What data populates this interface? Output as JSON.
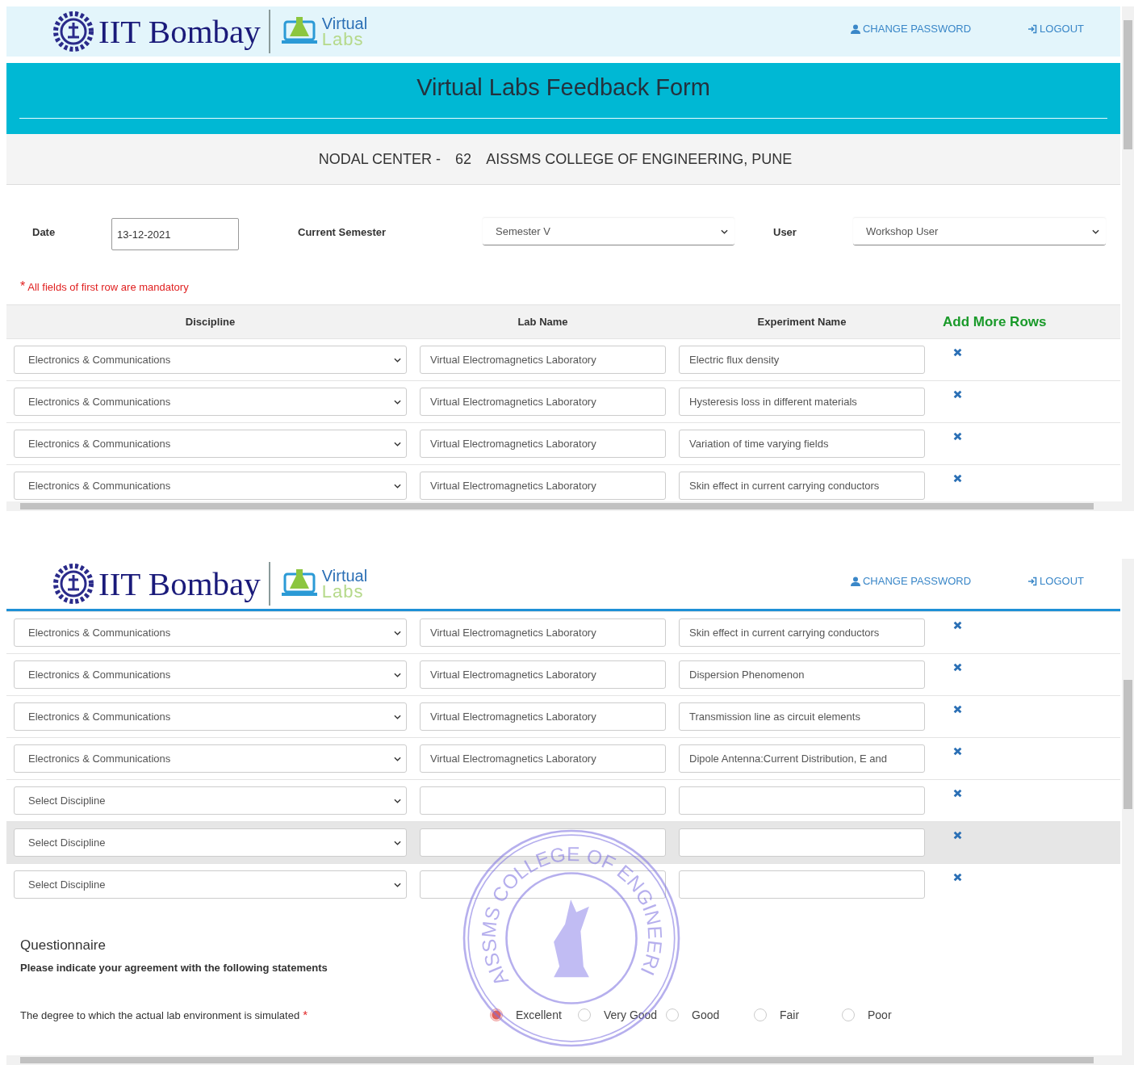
{
  "top_view": {
    "header": {
      "logo_text": "IIT Bombay",
      "labs_logo": {
        "line_1": "Virtual",
        "line_2": "Labs"
      },
      "links": [
        {
          "kind": "password",
          "label": "CHANGE PASSWORD"
        },
        {
          "kind": "logout",
          "label": "LOGOUT"
        }
      ]
    },
    "title": "Virtual Labs Feedback Form",
    "nodal_center": {
      "label": "NODAL CENTER -",
      "code": "62",
      "name": "AISSMS COLLEGE OF ENGINEERING, PUNE"
    },
    "fields": {
      "date": {
        "label": "Date",
        "value": "13-12-2021"
      },
      "semester": {
        "label": "Current Semester",
        "value": "Semester V"
      },
      "user": {
        "label": "User",
        "value": "Workshop User"
      }
    },
    "mandatory_note": {
      "mark": "*",
      "text": "All fields of first row are mandatory"
    },
    "table": {
      "columns": [
        "Discipline",
        "Lab Name",
        "Experiment Name"
      ],
      "add_rows_link": "Add More Rows",
      "rows": [
        {
          "discipline": "Electronics & Communications",
          "lab_name": "Virtual Electromagnetics Laboratory",
          "experiment": "Electric flux density",
          "highlighted": false
        },
        {
          "discipline": "Electronics & Communications",
          "lab_name": "Virtual Electromagnetics Laboratory",
          "experiment": "Hysteresis loss in different materials",
          "highlighted": false
        },
        {
          "discipline": "Electronics & Communications",
          "lab_name": "Virtual Electromagnetics Laboratory",
          "experiment": "Variation of time varying fields",
          "highlighted": false
        },
        {
          "discipline": "Electronics & Communications",
          "lab_name": "Virtual Electromagnetics Laboratory",
          "experiment": "Skin effect in current carrying conductors",
          "highlighted": false
        }
      ]
    }
  },
  "bottom_view": {
    "header": {
      "logo_text": "IIT Bombay",
      "labs_logo": {
        "line_1": "Virtual",
        "line_2": "Labs"
      },
      "links": [
        {
          "kind": "password",
          "label": "CHANGE PASSWORD"
        },
        {
          "kind": "logout",
          "label": "LOGOUT"
        }
      ]
    },
    "rows": [
      {
        "discipline": "Electronics & Communications",
        "lab_name": "Virtual Electromagnetics Laboratory",
        "experiment": "Skin effect in current carrying conductors",
        "highlighted": false
      },
      {
        "discipline": "Electronics & Communications",
        "lab_name": "Virtual Electromagnetics Laboratory",
        "experiment": "Dispersion Phenomenon",
        "highlighted": false
      },
      {
        "discipline": "Electronics & Communications",
        "lab_name": "Virtual Electromagnetics Laboratory",
        "experiment": "Transmission line as circuit elements",
        "highlighted": false
      },
      {
        "discipline": "Electronics & Communications",
        "lab_name": "Virtual Electromagnetics Laboratory",
        "experiment": "Dipole Antenna:Current Distribution, E and",
        "highlighted": false
      },
      {
        "discipline": "Select Discipline",
        "lab_name": "",
        "experiment": "",
        "highlighted": false
      },
      {
        "discipline": "Select Discipline",
        "lab_name": "",
        "experiment": "",
        "highlighted": true
      },
      {
        "discipline": "Select Discipline",
        "lab_name": "",
        "experiment": "",
        "highlighted": false
      }
    ],
    "questionnaire": {
      "title": "Questionnaire",
      "instruction": "Please indicate your agreement with the following statements",
      "questions": [
        {
          "text": "The degree to which the actual lab environment is simulated",
          "mark": "*",
          "options": [
            {
              "label": "Excellent",
              "selected": true
            },
            {
              "label": "Very Good",
              "selected": false
            },
            {
              "label": "Good",
              "selected": false
            },
            {
              "label": "Fair",
              "selected": false
            },
            {
              "label": "Poor",
              "selected": false
            }
          ]
        }
      ]
    },
    "stamp": {
      "text": "AISSMS COLLEGE OF ENGINEERI"
    }
  }
}
